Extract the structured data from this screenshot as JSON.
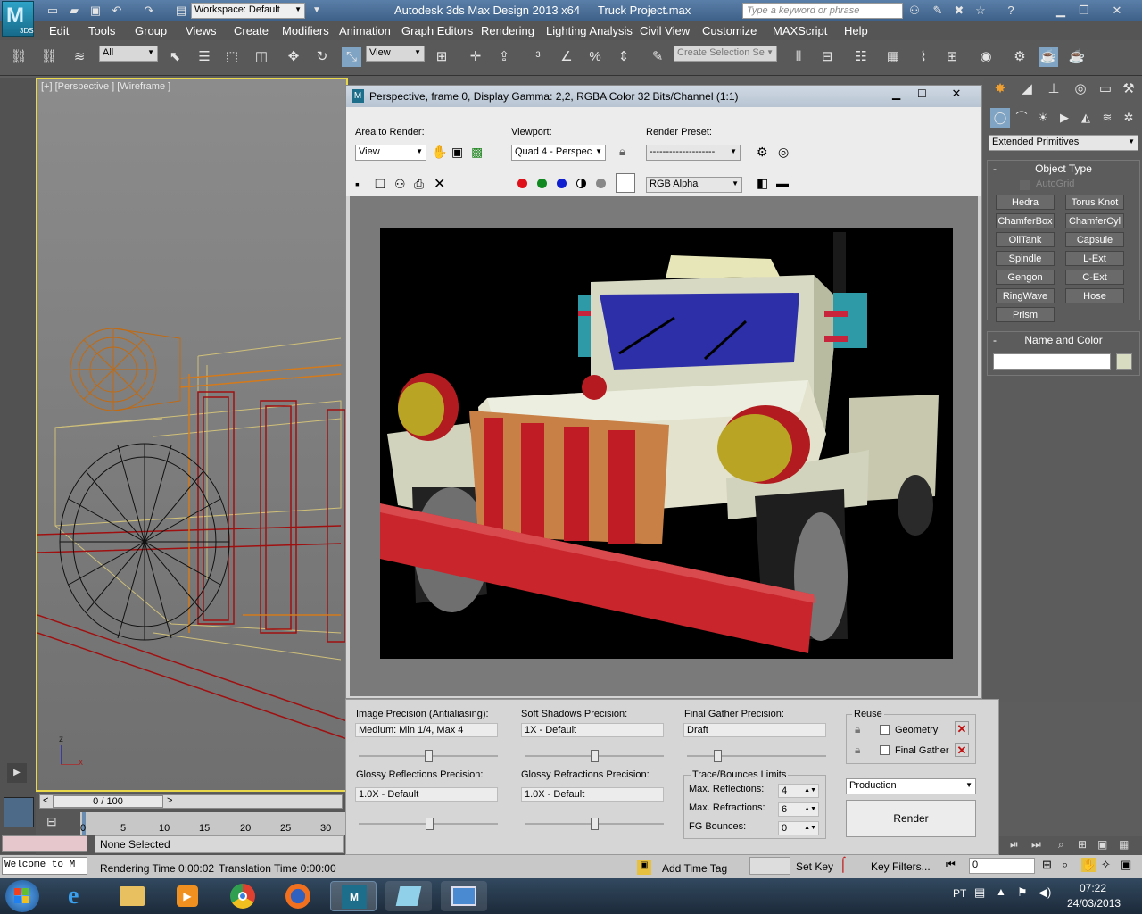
{
  "app": {
    "logo_text": "3DS",
    "workspace": "Workspace: Default",
    "title": "Autodesk 3ds Max Design 2013 x64",
    "file": "Truck Project.max",
    "search_placeholder": "Type a keyword or phrase"
  },
  "menu": [
    "Edit",
    "Tools",
    "Group",
    "Views",
    "Create",
    "Modifiers",
    "Animation",
    "Graph Editors",
    "Rendering",
    "Lighting Analysis",
    "Civil View",
    "Customize",
    "MAXScript",
    "Help"
  ],
  "toolbar": {
    "filter": "All",
    "ref_coord": "View",
    "selection_set_placeholder": "Create Selection Se"
  },
  "viewport": {
    "label": "[+] [Perspective ] [Wireframe ]",
    "axis_z": "z",
    "axis_x": "x"
  },
  "render_window": {
    "title": "Perspective, frame 0, Display Gamma: 2,2, RGBA Color 32 Bits/Channel (1:1)",
    "area_label": "Area to Render:",
    "area_value": "View",
    "viewport_label": "Viewport:",
    "viewport_value": "Quad 4 - Perspec",
    "preset_label": "Render Preset:",
    "preset_value": "--------------------",
    "channel": "RGB Alpha"
  },
  "command_panel": {
    "category": "Extended Primitives",
    "object_type": "Object Type",
    "autogrid": "AutoGrid",
    "buttons": [
      "Hedra",
      "Torus Knot",
      "ChamferBox",
      "ChamferCyl",
      "OilTank",
      "Capsule",
      "Spindle",
      "L-Ext",
      "Gengon",
      "C-Ext",
      "RingWave",
      "Hose",
      "Prism"
    ],
    "name_color": "Name and Color"
  },
  "settings": {
    "image_precision_label": "Image Precision (Antialiasing):",
    "image_precision_value": "Medium: Min 1/4, Max 4",
    "soft_shadows_label": "Soft Shadows Precision:",
    "soft_shadows_value": "1X - Default",
    "final_gather_label": "Final Gather Precision:",
    "final_gather_value": "Draft",
    "glossy_refl_label": "Glossy Reflections Precision:",
    "glossy_refl_value": "1.0X - Default",
    "glossy_refr_label": "Glossy Refractions Precision:",
    "glossy_refr_value": "1.0X - Default",
    "reuse_label": "Reuse",
    "geometry": "Geometry",
    "final_gather": "Final Gather",
    "trace_label": "Trace/Bounces Limits",
    "max_refl_label": "Max. Reflections:",
    "max_refl_value": "4",
    "max_refr_label": "Max. Refractions:",
    "max_refr_value": "6",
    "fg_bounces_label": "FG Bounces:",
    "fg_bounces_value": "0",
    "mode": "Production",
    "render_button": "Render"
  },
  "timeline": {
    "frame": "0 / 100",
    "ticks": [
      "0",
      "5",
      "10",
      "15",
      "20",
      "25",
      "30"
    ]
  },
  "status": {
    "maxscript": "Welcome to M",
    "selection": "None Selected",
    "render_time": "Rendering Time  0:00:02",
    "translation_time": "Translation Time  0:00:00",
    "add_time_tag": "Add Time Tag",
    "set_key": "Set Key",
    "key_filters": "Key Filters...",
    "frame_field": "0"
  },
  "tray": {
    "lang": "PT",
    "time": "07:22",
    "date": "24/03/2013"
  }
}
